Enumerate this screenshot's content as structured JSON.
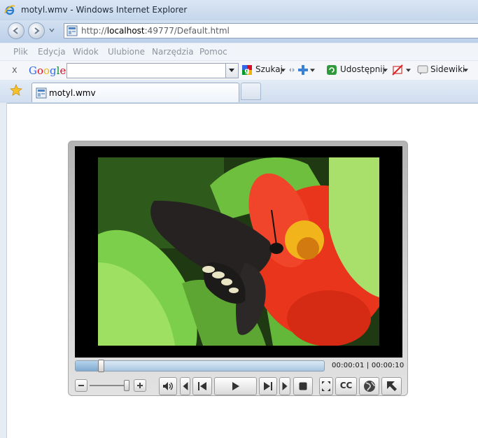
{
  "window": {
    "title": "motyl.wmv - Windows Internet Explorer"
  },
  "navigation": {
    "url_prefix": "http://",
    "url_host": "localhost",
    "url_rest": ":49777/Default.html"
  },
  "menu": {
    "items": [
      "Plik",
      "Edycja",
      "Widok",
      "Ulubione",
      "Narzędzia",
      "Pomoc"
    ]
  },
  "google_toolbar": {
    "close_label": "x",
    "logo": [
      "G",
      "o",
      "o",
      "g",
      "l",
      "e"
    ],
    "logo_colors": [
      "#3369e8",
      "#d50f25",
      "#eeb211",
      "#3369e8",
      "#009925",
      "#d50f25"
    ],
    "search_value": "",
    "search_label": "Szukaj",
    "share_label": "Udostępnij",
    "sidewiki_label": "Sidewiki"
  },
  "tabs": [
    {
      "label": "motyl.wmv"
    }
  ],
  "player": {
    "progress_fraction": 0.1,
    "time_current": "00:00:01",
    "time_separator": "|",
    "time_total": "00:00:10",
    "volume_fraction": 0.95,
    "cc_label": "CC"
  },
  "colors": {
    "titlebar": "#c5d6ec",
    "player_frame": "#d5d5d5",
    "timeline": "#a9c6e0",
    "flower": "#e8351c",
    "leaf": "#6cb53a"
  }
}
